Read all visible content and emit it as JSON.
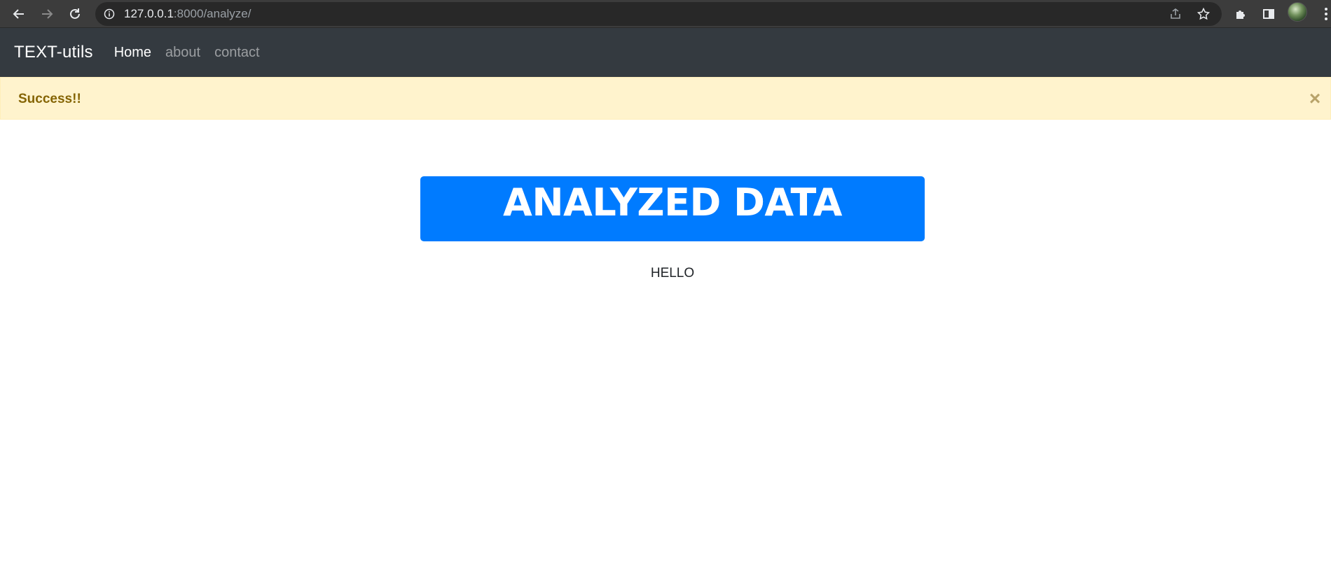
{
  "browser": {
    "url_host": "127.0.0.1",
    "url_path": ":8000/analyze/",
    "icons": [
      "back-arrow-icon",
      "forward-arrow-icon",
      "reload-icon",
      "info-icon",
      "share-icon",
      "star-icon",
      "puzzle-icon",
      "side-panel-icon",
      "profile-avatar",
      "kebab-menu-icon"
    ]
  },
  "navbar": {
    "brand": "TEXT-utils",
    "links": [
      {
        "label": "Home",
        "active": true
      },
      {
        "label": "about",
        "active": false
      },
      {
        "label": "contact",
        "active": false
      }
    ],
    "bg_color": "#343a40"
  },
  "alert": {
    "message": "Success!!",
    "close_glyph": "×",
    "bg_color": "#fff3cd",
    "text_color": "#856404"
  },
  "main": {
    "heading": "ANALYZED DATA",
    "heading_bg_color": "#007bff",
    "result": "HELLO"
  }
}
